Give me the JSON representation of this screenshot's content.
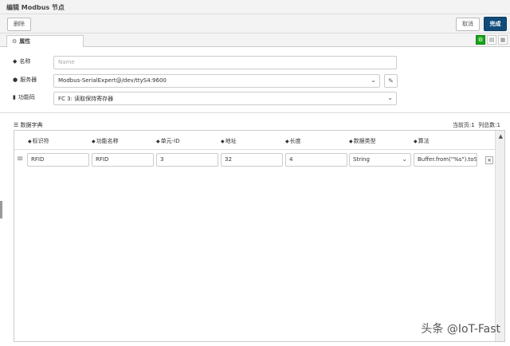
{
  "window": {
    "title": "编辑 Modbus 节点"
  },
  "toolbar": {
    "delete_label": "删除",
    "cancel_label": "取消",
    "done_label": "完成"
  },
  "tabs": [
    {
      "label": "属性"
    }
  ],
  "form": {
    "name": {
      "label": "名称",
      "placeholder": "Name",
      "value": ""
    },
    "server": {
      "label": "服务器",
      "value": "Modbus-SerialExpert@/dev/ttyS4:9600"
    },
    "function": {
      "label": "功能码",
      "value": "FC 3: 读取保持寄存器"
    }
  },
  "dictionary": {
    "title": "数据字典",
    "current_page": "当前页:1",
    "column_count": "列总数:1",
    "columns": [
      "标识符",
      "功能名称",
      "单元-ID",
      "地址",
      "长度",
      "数据类型",
      "算法"
    ],
    "rows": [
      [
        "RFID",
        "RFID",
        "3",
        "32",
        "4",
        "String",
        "Buffer.from(\"%s\").toStri"
      ]
    ]
  },
  "watermark": "头条 @IoT-Fast"
}
